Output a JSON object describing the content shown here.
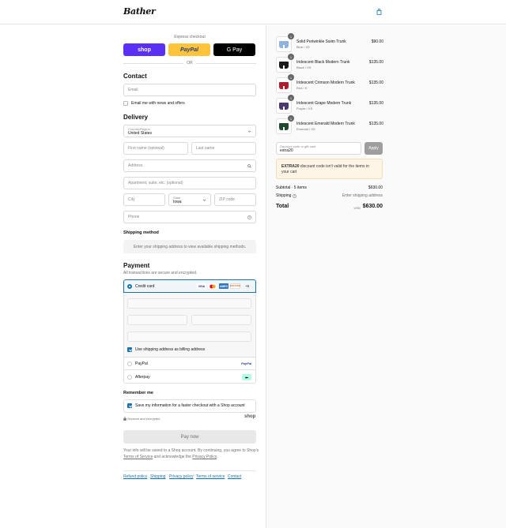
{
  "header": {
    "logo": "Bather",
    "cart_icon": "shopping-bag-icon"
  },
  "express": {
    "label": "Express checkout",
    "shop": "shop",
    "paypal": "PayPal",
    "gpay": "G Pay",
    "or": "OR"
  },
  "contact": {
    "title": "Contact",
    "email_placeholder": "Email",
    "newsletter_label": "Email me with news and offers",
    "newsletter_checked": false
  },
  "delivery": {
    "title": "Delivery",
    "country_label": "Country/Region",
    "country_value": "United States",
    "first_name": "First name (optional)",
    "last_name": "Last name",
    "address": "Address",
    "apartment": "Apartment, suite, etc. (optional)",
    "city": "City",
    "state_label": "State",
    "state_value": "Iowa",
    "zip": "ZIP code",
    "phone": "Phone"
  },
  "shipping_method": {
    "title": "Shipping method",
    "message": "Enter your shipping address to view available shipping methods."
  },
  "payment": {
    "title": "Payment",
    "subtitle": "All transactions are secure and encrypted.",
    "credit_card": "Credit card",
    "card_logos": [
      "VISA",
      "MC",
      "AMEX",
      "DISCOVER"
    ],
    "more_cards": "+5",
    "billing_same": "Use shipping address as billing address",
    "paypal": "PayPal",
    "paypal_logo": "PayPal",
    "afterpay": "Afterpay"
  },
  "remember": {
    "title": "Remember me",
    "save_label": "Save my information for a faster checkout with a Shop account",
    "secure": "Secured and encrypted",
    "shop_logo": "shop"
  },
  "pay_now": "Pay now",
  "legal": {
    "text1": "Your info will be saved to a Shop account. By continuing, you agree to Shop's",
    "tos": "Terms of Service",
    "text2": "and acknowledge the",
    "privacy": "Privacy Policy",
    "end": "."
  },
  "footer": [
    "Refund policy",
    "Shipping",
    "Privacy policy",
    "Terms of service",
    "Contact"
  ],
  "cart": {
    "items": [
      {
        "name": "Solid Periwinkle Swim Trunk",
        "variant": "Blue / XS",
        "price": "$90.00",
        "qty": "1",
        "color": "#8fb3de"
      },
      {
        "name": "Iridescent Black Modern Trunk",
        "variant": "Black / XS",
        "price": "$135.00",
        "qty": "1",
        "color": "#1a1a1a"
      },
      {
        "name": "Iridescent Crimson Modern Trunk",
        "variant": "Red / S",
        "price": "$135.00",
        "qty": "1",
        "color": "#b01c2e"
      },
      {
        "name": "Iridescent Grape Modern Trunk",
        "variant": "Purple / XS",
        "price": "$135.00",
        "qty": "1",
        "color": "#4b3a6e"
      },
      {
        "name": "Iridescent Emerald Modern Trunk",
        "variant": "Emerald / XS",
        "price": "$135.00",
        "qty": "1",
        "color": "#1f4a2e"
      }
    ],
    "discount_label": "Discount code or gift card",
    "discount_value": "extra20",
    "apply": "Apply",
    "warning_code": "EXTRA20",
    "warning_text": "discount code isn't valid for the items in your cart",
    "subtotal_label": "Subtotal · 5 items",
    "subtotal_value": "$630.00",
    "shipping_label": "Shipping",
    "shipping_value": "Enter shipping address",
    "total_label": "Total",
    "currency": "USD",
    "total_value": "$630.00"
  }
}
